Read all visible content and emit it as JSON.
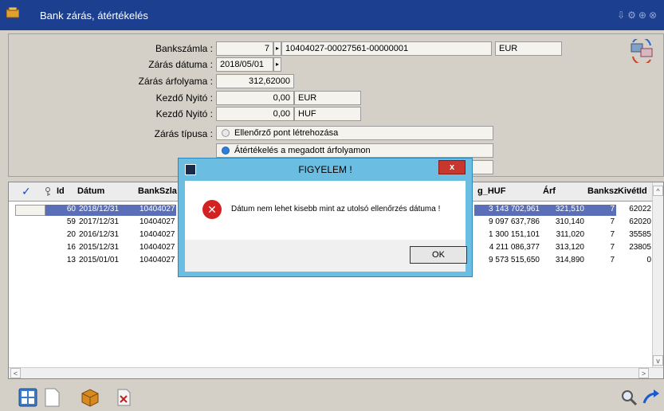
{
  "window": {
    "title": "Bank zárás, átértékelés"
  },
  "form": {
    "bankszamla_label": "Bankszámla :",
    "bankszamla_id": "7",
    "bankszamla_number": "10404027-00027561-00000001",
    "currency": "EUR",
    "zaras_datuma_label": "Zárás dátuma :",
    "zaras_datuma": "2018/05/01",
    "zaras_arfolyama_label": "Zárás árfolyama :",
    "zaras_arfolyama": "312,62000",
    "kezdo_nyito_label_1": "Kezdő Nyitó :",
    "kezdo_nyito_value_1": "0,00",
    "kezdo_nyito_currency_1": "EUR",
    "kezdo_nyito_label_2": "Kezdő Nyitó :",
    "kezdo_nyito_value_2": "0,00",
    "kezdo_nyito_currency_2": "HUF",
    "zaras_tipusa_label": "Zárás típusa :",
    "options": [
      {
        "label": "Ellenőrző pont létrehozása",
        "selected": false
      },
      {
        "label": "Átértékelés a megadott árfolyamon",
        "selected": true
      }
    ]
  },
  "grid": {
    "headers": {
      "id": "Id",
      "datum": "Dátum",
      "bankszla": "BankSzla",
      "g_huf": "g_HUF",
      "arf": "Árf",
      "banksz": "Banksz",
      "kivetid": "KivétId"
    },
    "rows": [
      {
        "id": "60",
        "datum": "2018/12/31",
        "bankszla": "10404027",
        "g_huf": "3 143 702,961",
        "arf": "321,510",
        "banksz": "7",
        "kivetid": "62022",
        "selected": true
      },
      {
        "id": "59",
        "datum": "2017/12/31",
        "bankszla": "10404027",
        "g_huf": "9 097 637,786",
        "arf": "310,140",
        "banksz": "7",
        "kivetid": "62020",
        "selected": false
      },
      {
        "id": "20",
        "datum": "2016/12/31",
        "bankszla": "10404027",
        "g_huf": "1 300 151,101",
        "arf": "311,020",
        "banksz": "7",
        "kivetid": "35585",
        "selected": false
      },
      {
        "id": "16",
        "datum": "2015/12/31",
        "bankszla": "10404027",
        "g_huf": "4 211 086,377",
        "arf": "313,120",
        "banksz": "7",
        "kivetid": "23805",
        "selected": false
      },
      {
        "id": "13",
        "datum": "2015/01/01",
        "bankszla": "10404027",
        "g_huf": "9 573 515,650",
        "arf": "314,890",
        "banksz": "7",
        "kivetid": "0",
        "selected": false
      }
    ]
  },
  "dialog": {
    "title": "FIGYELEM !",
    "message": "Dátum nem lehet kisebb mint az utolsó ellenőrzés dátuma !",
    "ok_label": "OK",
    "close_glyph": "x"
  },
  "colors": {
    "titlebar": "#1c3f8f",
    "dialog_frame": "#6cbde2",
    "selection": "#5a6fb7",
    "error": "#d32020"
  }
}
